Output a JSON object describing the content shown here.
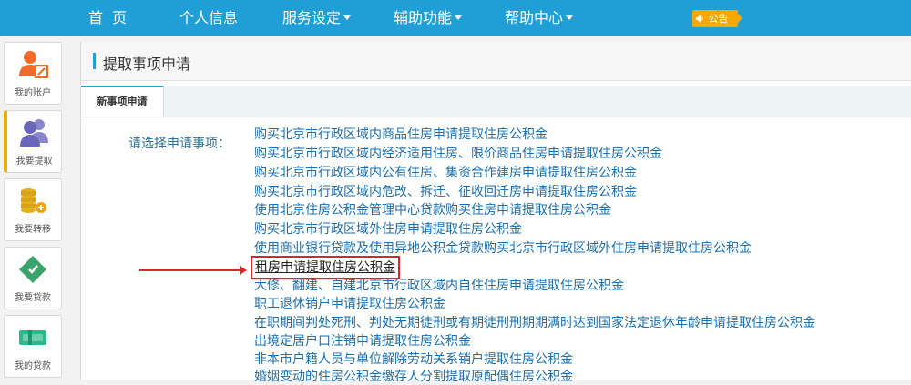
{
  "nav": {
    "items": [
      {
        "label": "首  页",
        "dropdown": false
      },
      {
        "label": "个人信息",
        "dropdown": false
      },
      {
        "label": "服务设定",
        "dropdown": true
      },
      {
        "label": "辅助功能",
        "dropdown": true
      },
      {
        "label": "帮助中心",
        "dropdown": true
      }
    ],
    "notice": {
      "icon": "speaker-icon",
      "label": "公告"
    }
  },
  "sidebar": {
    "items": [
      {
        "label": "我的账户",
        "icon": "user-edit-icon",
        "active": false
      },
      {
        "label": "我要提取",
        "icon": "users-icon",
        "active": true
      },
      {
        "label": "我要转移",
        "icon": "coins-transfer-icon",
        "active": false
      },
      {
        "label": "我要贷款",
        "icon": "loan-tag-icon",
        "active": false
      },
      {
        "label": "我的贷款",
        "icon": "money-stack-icon",
        "active": false
      }
    ]
  },
  "page": {
    "title": "提取事项申请",
    "tab": "新事项申请"
  },
  "form": {
    "prompt": "请选择申请事项：",
    "options": [
      "购买北京市行政区域内商品住房申请提取住房公积金",
      "购买北京市行政区域内经济适用住房、限价商品住房申请提取住房公积金",
      "购买北京市行政区域内公有住房、集资合作建房申请提取住房公积金",
      "购买北京市行政区域内危改、拆迁、征收回迁房申请提取住房公积金",
      "使用北京住房公积金管理中心贷款购买住房申请提取住房公积金",
      "购买北京市行政区域外住房申请提取住房公积金",
      "使用商业银行贷款及使用异地公积金贷款购买北京市行政区域外住房申请提取住房公积金",
      "租房申请提取住房公积金",
      "大修、翻建、自建北京市行政区域内自住住房申请提取住房公积金",
      "职工退休销户申请提取住房公积金",
      "在职期间判处死刑、判处无期徒刑或有期徒刑刑期期满时达到国家法定退休年龄申请提取住房公积金",
      "出境定居户口注销申请提取住房公积金",
      "非本市户籍人员与单位解除劳动关系销户提取住房公积金",
      "婚姻变动的住房公积金缴存人分割提取原配偶住房公积金"
    ],
    "highlighted_index": 7
  },
  "colors": {
    "topbar": "#1f9fd6",
    "link": "#1a6fb0",
    "notice": "#f5a800",
    "highlight": "#d9262a"
  }
}
